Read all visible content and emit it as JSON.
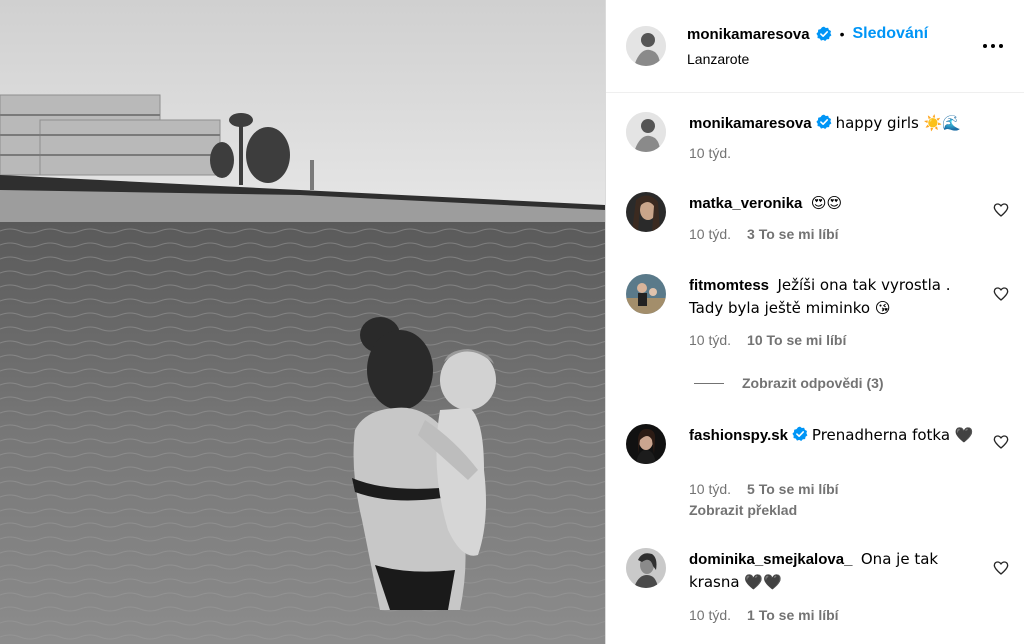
{
  "post": {
    "username": "monikamaresova",
    "follow_label": "Sledování",
    "location": "Lanzarote"
  },
  "caption": {
    "username": "monikamaresova",
    "text": "happy girls ☀️🌊",
    "time": "10 týd."
  },
  "comments": [
    {
      "username": "matka_veronika",
      "text": "😍😍",
      "time": "10 týd.",
      "likes": "3 To se mi líbí"
    },
    {
      "username": "fitmomtess",
      "text": "Ježíši ona tak vyrostla . Tady byla ještě miminko 😘",
      "time": "10 týd.",
      "likes": "10 To se mi líbí"
    },
    {
      "username": "fashionspy.sk",
      "text": "Prenadherna fotka 🖤",
      "time": "10 týd.",
      "likes": "5 To se mi líbí",
      "translate": "Zobrazit překlad"
    },
    {
      "username": "dominika_smejkalova_",
      "text": "Ona je tak krasna 🖤🖤",
      "time": "10 týd.",
      "likes": "1 To se mi líbí"
    }
  ],
  "view_replies": "Zobrazit odpovědi (3)",
  "colors": {
    "accent": "#0095f6",
    "verified": "#0095f6",
    "secondary_text": "#737373",
    "border": "#dbdbdb"
  },
  "icons": [
    "verified-badge-icon",
    "more-options-icon",
    "heart-icon"
  ]
}
